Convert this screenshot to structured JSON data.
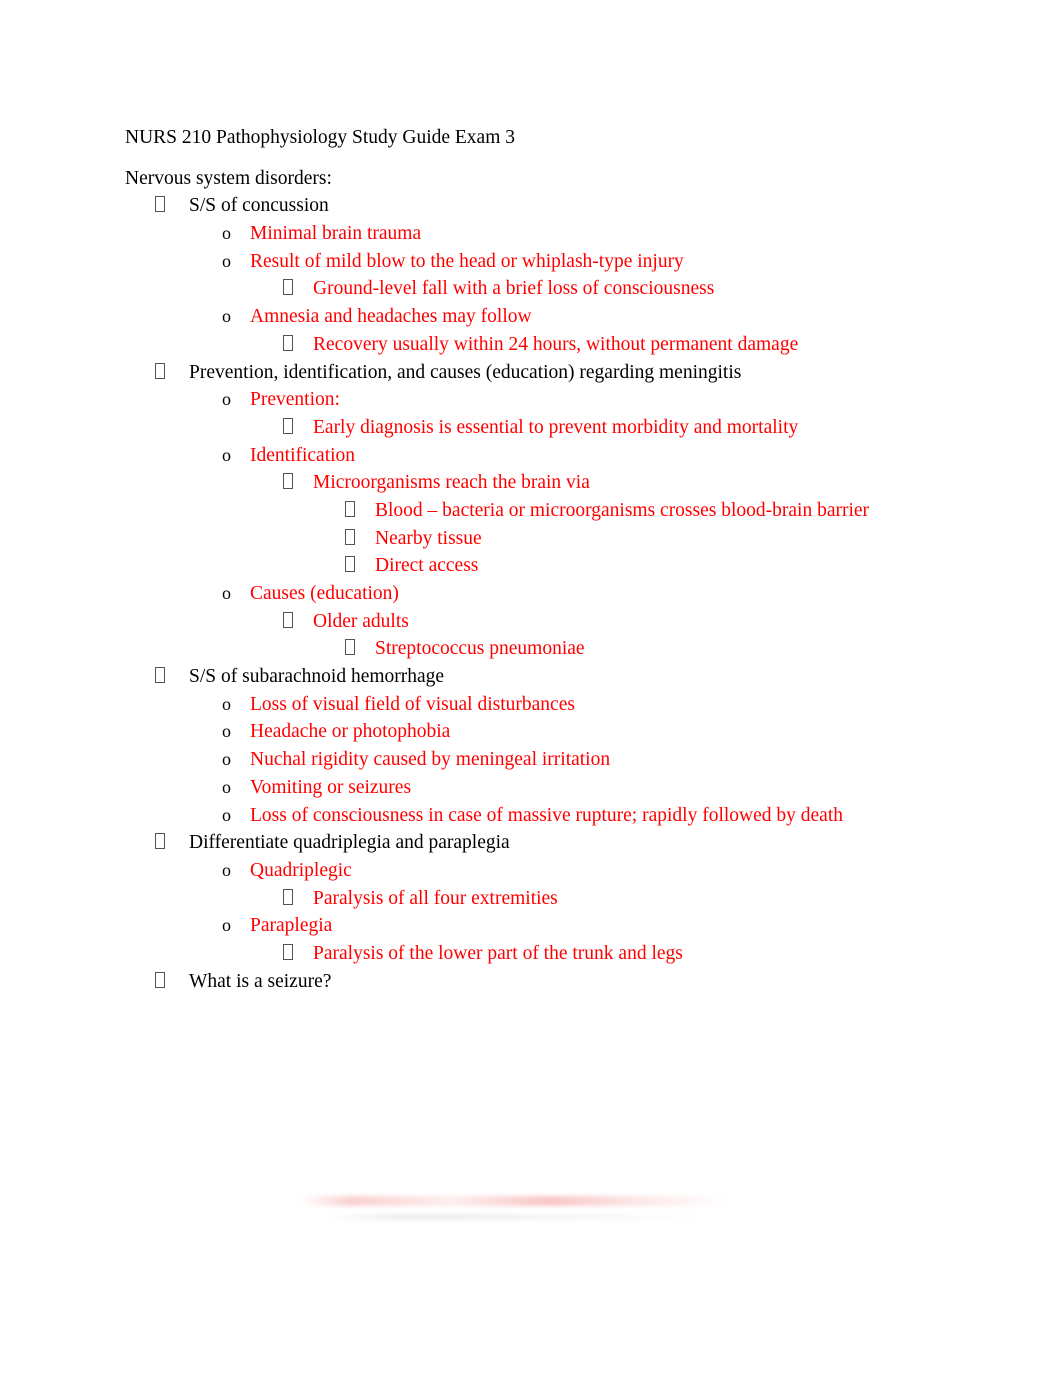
{
  "document": {
    "title": "NURS 210 Pathophysiology Study Guide Exam 3",
    "section_heading": "Nervous system disorders:",
    "colors": {
      "body_text": "#000000",
      "highlight_text": "#ff0000",
      "bullet_marker": "#3a3a3a",
      "page_background": "#ffffff"
    },
    "markers": {
      "level1": "tofu-box",
      "level2": "o",
      "level3": "tofu-box",
      "level4": "tofu-box"
    }
  },
  "outline": [
    {
      "level": 1,
      "color": "black",
      "text": "S/S of concussion"
    },
    {
      "level": 2,
      "color": "red",
      "text": "Minimal brain trauma"
    },
    {
      "level": 2,
      "color": "red",
      "text": "Result of mild blow to the head or whiplash-type injury"
    },
    {
      "level": 3,
      "color": "red",
      "text": "Ground-level fall with a brief loss of consciousness"
    },
    {
      "level": 2,
      "color": "red",
      "text": "Amnesia and headaches may follow"
    },
    {
      "level": 3,
      "color": "red",
      "text": "Recovery usually within 24 hours, without permanent damage"
    },
    {
      "level": 1,
      "color": "black",
      "text": "Prevention, identification, and causes (education) regarding meningitis"
    },
    {
      "level": 2,
      "color": "red",
      "text": "Prevention:"
    },
    {
      "level": 3,
      "color": "red",
      "text": "Early diagnosis is essential to prevent morbidity and mortality"
    },
    {
      "level": 2,
      "color": "red",
      "text": "Identification"
    },
    {
      "level": 3,
      "color": "red",
      "text": "Microorganisms reach the brain via"
    },
    {
      "level": 4,
      "color": "red",
      "text": "Blood – bacteria or microorganisms crosses blood-brain barrier"
    },
    {
      "level": 4,
      "color": "red",
      "text": "Nearby tissue"
    },
    {
      "level": 4,
      "color": "red",
      "text": "Direct access"
    },
    {
      "level": 2,
      "color": "red",
      "text": "Causes (education)"
    },
    {
      "level": 3,
      "color": "red",
      "text": "Older adults"
    },
    {
      "level": 4,
      "color": "red",
      "text": "Streptococcus pneumoniae"
    },
    {
      "level": 1,
      "color": "black",
      "text": "S/S of subarachnoid hemorrhage"
    },
    {
      "level": 2,
      "color": "red",
      "text": "Loss of visual field of visual disturbances"
    },
    {
      "level": 2,
      "color": "red",
      "text": "Headache or photophobia"
    },
    {
      "level": 2,
      "color": "red",
      "text": "Nuchal rigidity caused by meningeal irritation"
    },
    {
      "level": 2,
      "color": "red",
      "text": "Vomiting or seizures"
    },
    {
      "level": 2,
      "color": "red",
      "text": "Loss of consciousness in case of massive rupture; rapidly followed by death"
    },
    {
      "level": 1,
      "color": "black",
      "text": "Differentiate quadriplegia and paraplegia"
    },
    {
      "level": 2,
      "color": "red",
      "text": "Quadriplegic"
    },
    {
      "level": 3,
      "color": "red",
      "text": "Paralysis of all four extremities"
    },
    {
      "level": 2,
      "color": "red",
      "text": "Paraplegia"
    },
    {
      "level": 3,
      "color": "red",
      "text": "Paralysis of the lower part of the trunk and legs"
    },
    {
      "level": 1,
      "color": "black",
      "text": "What is a seizure?"
    }
  ]
}
